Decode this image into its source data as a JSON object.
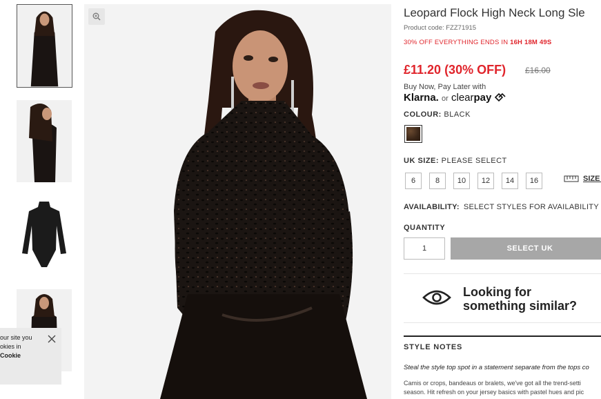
{
  "gallery": {
    "thumbnails": [
      {
        "alt": "model front view",
        "active": true
      },
      {
        "alt": "model side view",
        "active": false
      },
      {
        "alt": "product flat lay",
        "active": false
      },
      {
        "alt": "model front view 2",
        "active": false
      }
    ],
    "main_alt": "model wearing leopard flock high neck top",
    "zoom_icon": "zoom-in-icon"
  },
  "cookie_banner": {
    "line1": "our site you",
    "line2": "okies in",
    "link": "Cookie"
  },
  "product": {
    "title": "Leopard Flock High Neck Long Sle",
    "code": "Product code: FZZ71915",
    "promo_text": "30% OFF EVERYTHING ENDS IN",
    "promo_timer": "16H 18M 49S",
    "price": "£11.20 (30% OFF)",
    "was_price": "£16.00",
    "bnpl_text": "Buy Now, Pay Later with",
    "klarna": "Klarna.",
    "or": "or",
    "clearpay_a": "clear",
    "clearpay_b": "pay",
    "colour_label": "COLOUR:",
    "colour_value": "BLACK",
    "size_label": "UK SIZE:",
    "size_value": "PLEASE SELECT",
    "sizes": [
      "6",
      "8",
      "10",
      "12",
      "14",
      "16"
    ],
    "size_guide": "SIZE G",
    "availability_label": "AVAILABILITY:",
    "availability_value": "SELECT STYLES FOR AVAILABILITY",
    "quantity_label": "QUANTITY",
    "quantity_value": "1",
    "select_button": "SELECT UK",
    "similar_line1": "Looking for",
    "similar_line2": "something similar?",
    "style_notes_heading": "STYLE NOTES",
    "style_notes_lead": "Steal the style top spot in a statement separate from the tops co",
    "style_notes_body1": "Camis or crops, bandeaus or bralets, we've got all the trend-setti",
    "style_notes_body2": "season. Hit refresh on your jersey basics with pastel hues and pic"
  },
  "colors": {
    "sale_red": "#e0242b",
    "button_grey": "#a7a7a7"
  }
}
